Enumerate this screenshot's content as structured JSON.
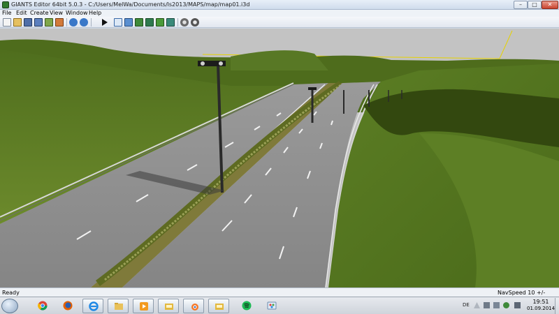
{
  "window": {
    "title": "GIANTS Editor 64bit 5.0.3 - C:/Users/MelWa/Documents/ls2013/MAPS/map/map01.i3d",
    "min_glyph": "–",
    "max_glyph": "□",
    "close_glyph": "✕"
  },
  "menu": {
    "items": [
      "File",
      "Edit",
      "Create",
      "View",
      "Window",
      "Help"
    ]
  },
  "toolbar": {
    "icons": [
      "new-file-icon",
      "open-file-icon",
      "save-icon",
      "save-as-icon",
      "import-icon",
      "export-icon",
      "undo-icon",
      "redo-icon",
      "play-icon",
      "select-icon",
      "move-icon",
      "terrain-sculpt-icon",
      "terrain-paint-icon",
      "foliage-paint-icon",
      "decal-paint-icon",
      "settings-icon",
      "gear-icon"
    ]
  },
  "viewport": {
    "colors": {
      "sky": "#c3c3c3",
      "grass": "#5a7a22",
      "grass_dark": "#3f5a16",
      "road": "#8a8a8a",
      "lane_mark": "#f2f2f2",
      "selection": "#e6d200"
    }
  },
  "status": {
    "left": "Ready",
    "right": "NavSpeed 10 +/-"
  },
  "taskbar": {
    "apps": [
      "chrome-icon",
      "firefox-icon",
      "internet-explorer-icon",
      "file-explorer-icon",
      "media-player-icon",
      "folder-icon",
      "blender-icon",
      "folder-icon",
      "spotify-icon",
      "paint-icon"
    ],
    "tray_language": "DE",
    "clock_time": "19:51",
    "clock_date": "01.09.2014"
  }
}
